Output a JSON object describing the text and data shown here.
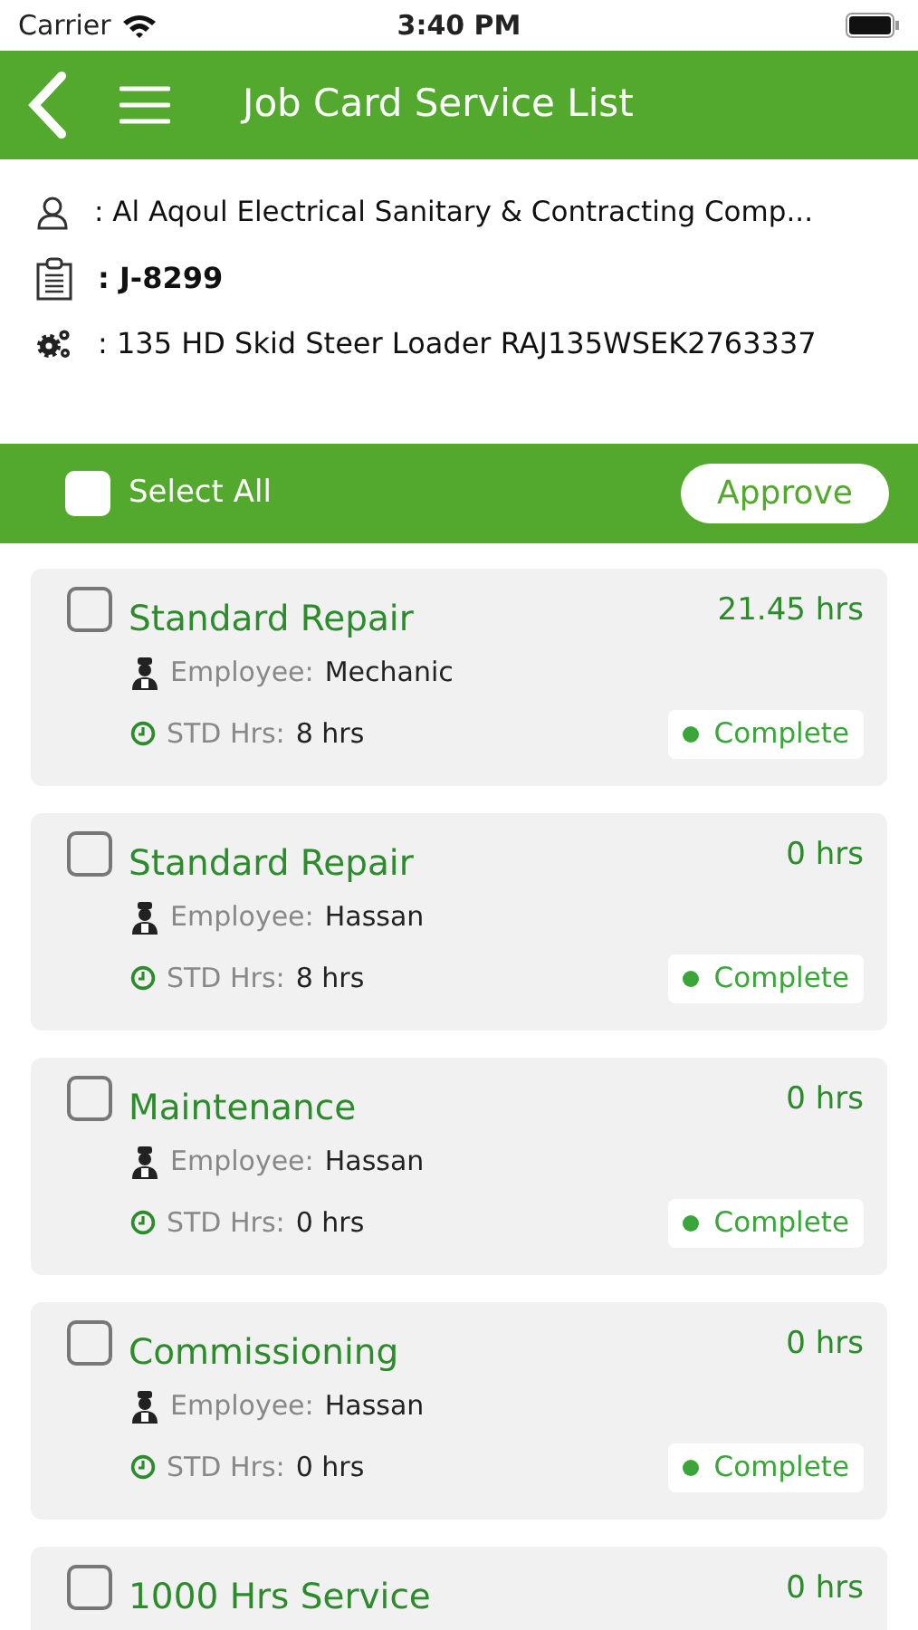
{
  "status_bar": {
    "carrier": "Carrier",
    "time": "3:40 PM"
  },
  "header": {
    "title": "Job Card Service List"
  },
  "info": {
    "customer": ": Al Aqoul Electrical Sanitary & Contracting Comp...",
    "job": ": J-8299",
    "equipment": ": 135 HD Skid Steer Loader RAJ135WSEK2763337"
  },
  "toolbar": {
    "select_all": {
      "label": "Select All",
      "checked": false
    },
    "approve": "Approve"
  },
  "services": [
    {
      "title": "Standard Repair",
      "hours": "21.45 hrs",
      "checked": false,
      "employee_label": "Employee:",
      "employee": "Mechanic",
      "std_label": "STD Hrs:",
      "std": "8 hrs",
      "status": "Complete"
    },
    {
      "title": "Standard Repair",
      "hours": "0 hrs",
      "checked": false,
      "employee_label": "Employee:",
      "employee": "Hassan",
      "std_label": "STD Hrs:",
      "std": "8 hrs",
      "status": "Complete"
    },
    {
      "title": "Maintenance",
      "hours": "0 hrs",
      "checked": false,
      "employee_label": "Employee:",
      "employee": "Hassan",
      "std_label": "STD Hrs:",
      "std": "0 hrs",
      "status": "Complete"
    },
    {
      "title": "Commissioning",
      "hours": "0 hrs",
      "checked": false,
      "employee_label": "Employee:",
      "employee": "Hassan",
      "std_label": "STD Hrs:",
      "std": "0 hrs",
      "status": "Complete"
    },
    {
      "title": "1000 Hrs Service",
      "hours": "0 hrs",
      "checked": false
    }
  ]
}
